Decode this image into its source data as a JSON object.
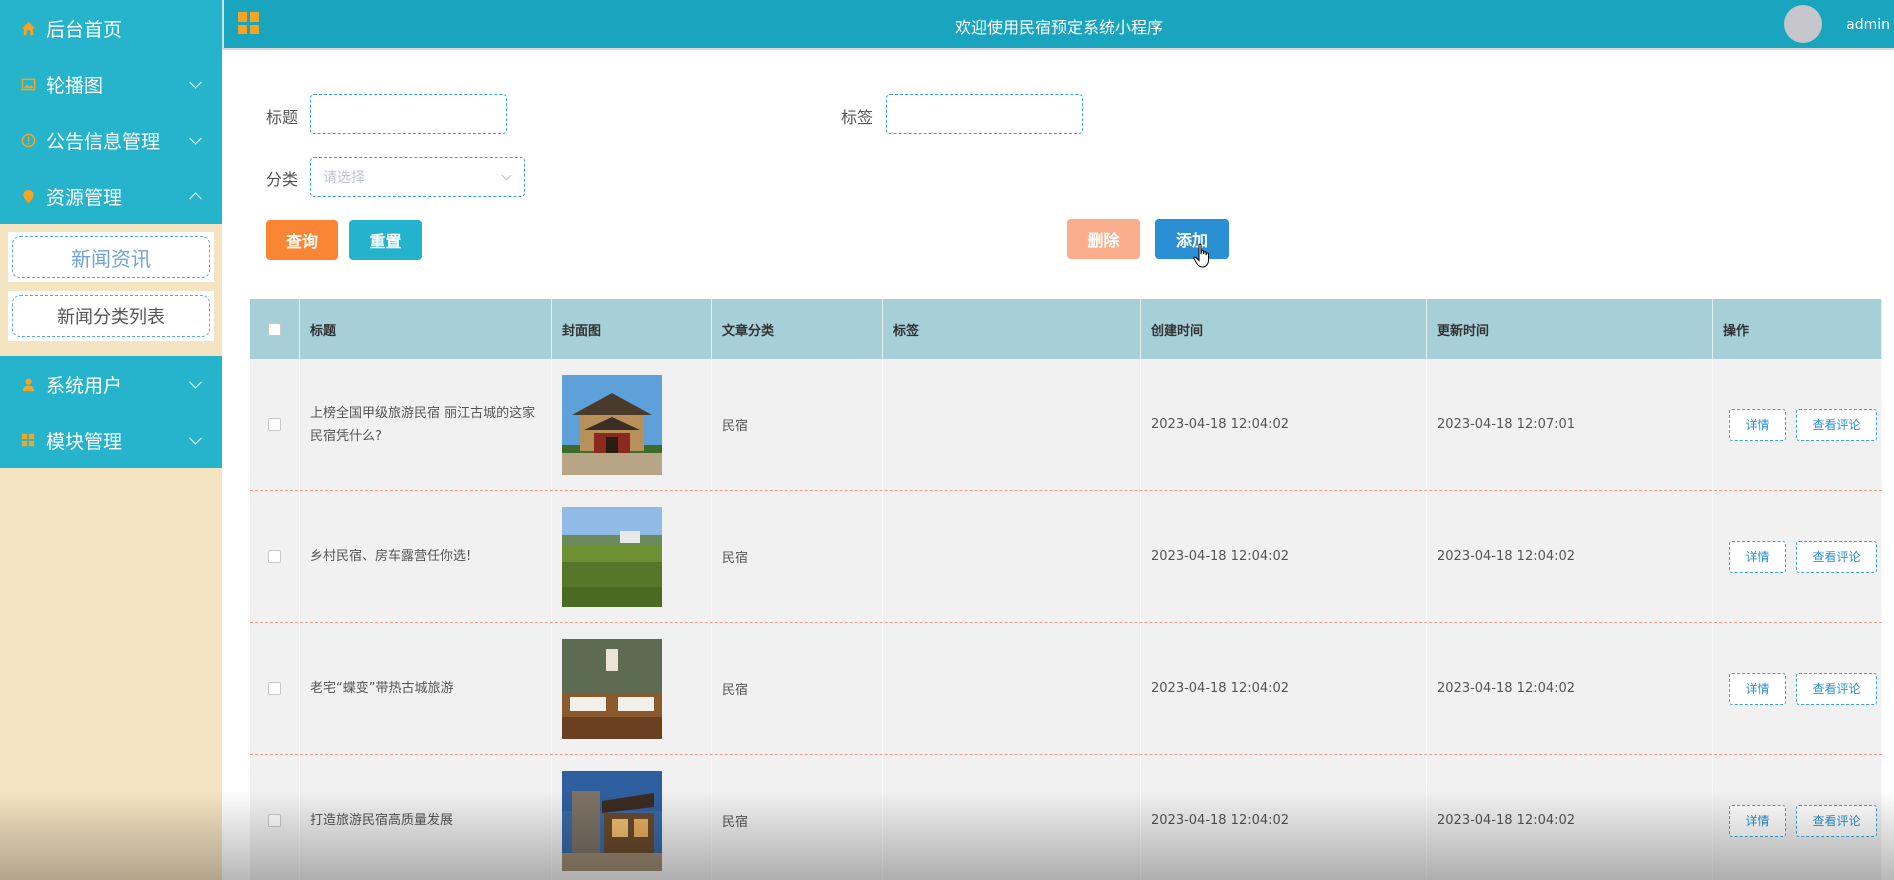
{
  "header": {
    "title": "欢迎使用民宿预定系统小程序",
    "user": "admin"
  },
  "sidebar": {
    "items": [
      {
        "label": "后台首页",
        "icon": "home-icon"
      },
      {
        "label": "轮播图",
        "icon": "image-icon"
      },
      {
        "label": "公告信息管理",
        "icon": "info-icon"
      },
      {
        "label": "资源管理",
        "icon": "location-pin-icon"
      },
      {
        "label": "系统用户",
        "icon": "user-icon"
      },
      {
        "label": "模块管理",
        "icon": "grid-icon"
      }
    ],
    "submenu": [
      "新闻资讯",
      "新闻分类列表"
    ]
  },
  "filters": {
    "title_label": "标题",
    "tag_label": "标签",
    "category_label": "分类",
    "category_placeholder": "请选择"
  },
  "buttons": {
    "search": "查询",
    "reset": "重置",
    "delete": "删除",
    "add": "添加"
  },
  "table": {
    "headers": [
      "标题",
      "封面图",
      "文章分类",
      "标签",
      "创建时间",
      "更新时间",
      "操作"
    ],
    "rows": [
      {
        "title": "上榜全国甲级旅游民宿 丽江古城的这家民宿凭什么?",
        "category": "民宿",
        "tag": "",
        "created": "2023-04-18 12:04:02",
        "updated": "2023-04-18 12:07:01"
      },
      {
        "title": "乡村民宿、房车露营任你选!",
        "category": "民宿",
        "tag": "",
        "created": "2023-04-18 12:04:02",
        "updated": "2023-04-18 12:04:02"
      },
      {
        "title": "老宅“蝶变”带热古城旅游",
        "category": "民宿",
        "tag": "",
        "created": "2023-04-18 12:04:02",
        "updated": "2023-04-18 12:04:02"
      },
      {
        "title": "打造旅游民宿高质量发展",
        "category": "民宿",
        "tag": "",
        "created": "2023-04-18 12:04:02",
        "updated": "2023-04-18 12:04:02"
      }
    ],
    "detail_label": "详情",
    "comments_label": "查看评论"
  }
}
